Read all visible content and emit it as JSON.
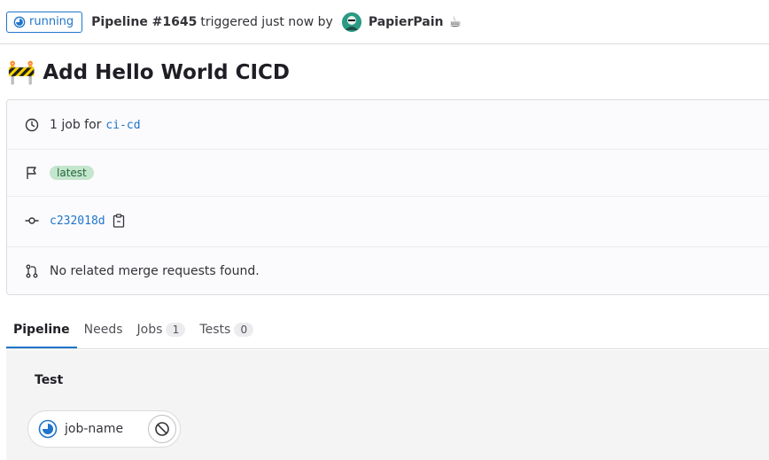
{
  "header": {
    "status": "running",
    "pipeline_label": "Pipeline #1645",
    "triggered_text": "triggered just now by",
    "author": "PapierPain",
    "author_emoji": "☕"
  },
  "title": {
    "emoji": "🚧",
    "text": "Add Hello World CICD"
  },
  "info": {
    "jobs_prefix": "1 job for",
    "branch": "ci-cd",
    "tag": "latest",
    "commit": "c232018d",
    "merge_requests": "No related merge requests found."
  },
  "tabs": [
    {
      "label": "Pipeline",
      "count": null
    },
    {
      "label": "Needs",
      "count": null
    },
    {
      "label": "Jobs",
      "count": "1"
    },
    {
      "label": "Tests",
      "count": "0"
    }
  ],
  "graph": {
    "stage": "Test",
    "job": "job-name"
  },
  "colors": {
    "accent": "#1f75cb",
    "tag_bg": "#c3e6cd",
    "tag_text": "#24663b"
  },
  "icons": {
    "status": "running-icon",
    "clock": "clock-icon",
    "flag": "flag-icon",
    "commit": "commit-icon",
    "copy": "clipboard-icon",
    "merge": "merge-request-icon",
    "cancel": "cancel-icon"
  }
}
